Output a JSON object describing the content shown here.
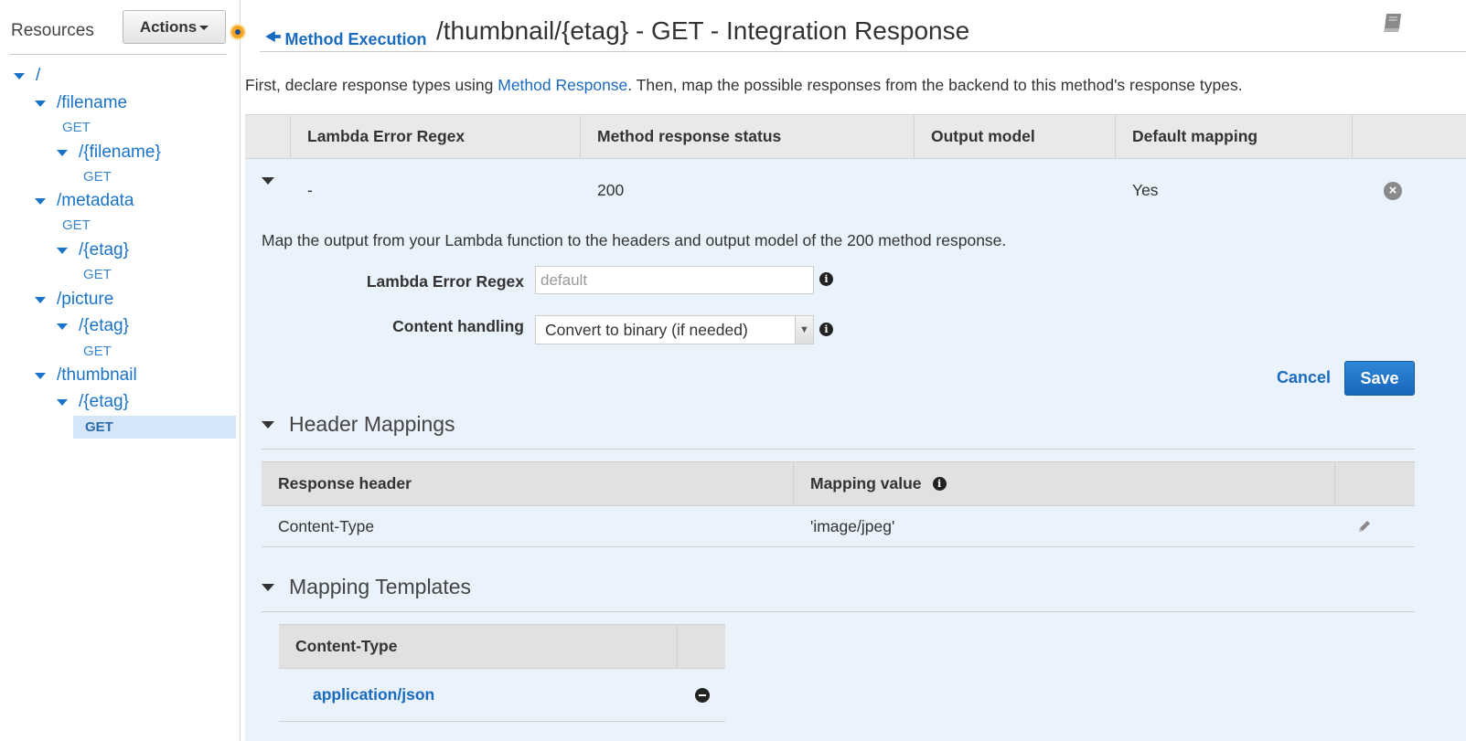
{
  "sidebar": {
    "title": "Resources",
    "actions_label": "Actions",
    "tree": [
      {
        "path": "/",
        "kind": "resource"
      },
      {
        "path": "/filename",
        "kind": "resource"
      },
      {
        "method": "GET"
      },
      {
        "path": "/{filename}",
        "kind": "resource"
      },
      {
        "method": "GET"
      },
      {
        "path": "/metadata",
        "kind": "resource"
      },
      {
        "method": "GET"
      },
      {
        "path": "/{etag}",
        "kind": "resource"
      },
      {
        "method": "GET"
      },
      {
        "path": "/picture",
        "kind": "resource"
      },
      {
        "path": "/{etag}",
        "kind": "resource"
      },
      {
        "method": "GET"
      },
      {
        "path": "/thumbnail",
        "kind": "resource"
      },
      {
        "path": "/{etag}",
        "kind": "resource"
      },
      {
        "method": "GET",
        "selected": true
      }
    ]
  },
  "header": {
    "back_label": "Method Execution",
    "title": "/thumbnail/{etag} - GET - Integration Response"
  },
  "intro": {
    "before": "First, declare response types using ",
    "link": "Method Response",
    "after": ". Then, map the possible responses from the backend to this method's response types."
  },
  "response_table": {
    "columns": [
      "Lambda Error Regex",
      "Method response status",
      "Output model",
      "Default mapping"
    ],
    "row": {
      "lambda_error_regex": "-",
      "status": "200",
      "output_model": "",
      "default_mapping": "Yes"
    }
  },
  "detail": {
    "description": "Map the output from your Lambda function to the headers and output model of the 200 method response.",
    "regex_label": "Lambda Error Regex",
    "regex_placeholder": "default",
    "regex_value": "",
    "content_handling_label": "Content handling",
    "content_handling_value": "Convert to binary (if needed)",
    "cancel_label": "Cancel",
    "save_label": "Save"
  },
  "header_mappings": {
    "title": "Header Mappings",
    "columns": [
      "Response header",
      "Mapping value"
    ],
    "rows": [
      {
        "header": "Content-Type",
        "value": "'image/jpeg'"
      }
    ]
  },
  "mapping_templates": {
    "title": "Mapping Templates",
    "column": "Content-Type",
    "rows": [
      {
        "content_type": "application/json"
      }
    ]
  },
  "colors": {
    "link": "#1a6bbf",
    "selected_bg": "#d4e6f7",
    "expanded_bg": "#eaf2fb",
    "save_button": "#1867bd"
  },
  "icons": [
    "pin-icon",
    "back-arrow-icon",
    "book-icon",
    "info-icon",
    "remove-icon",
    "pencil-icon",
    "minus-icon"
  ]
}
